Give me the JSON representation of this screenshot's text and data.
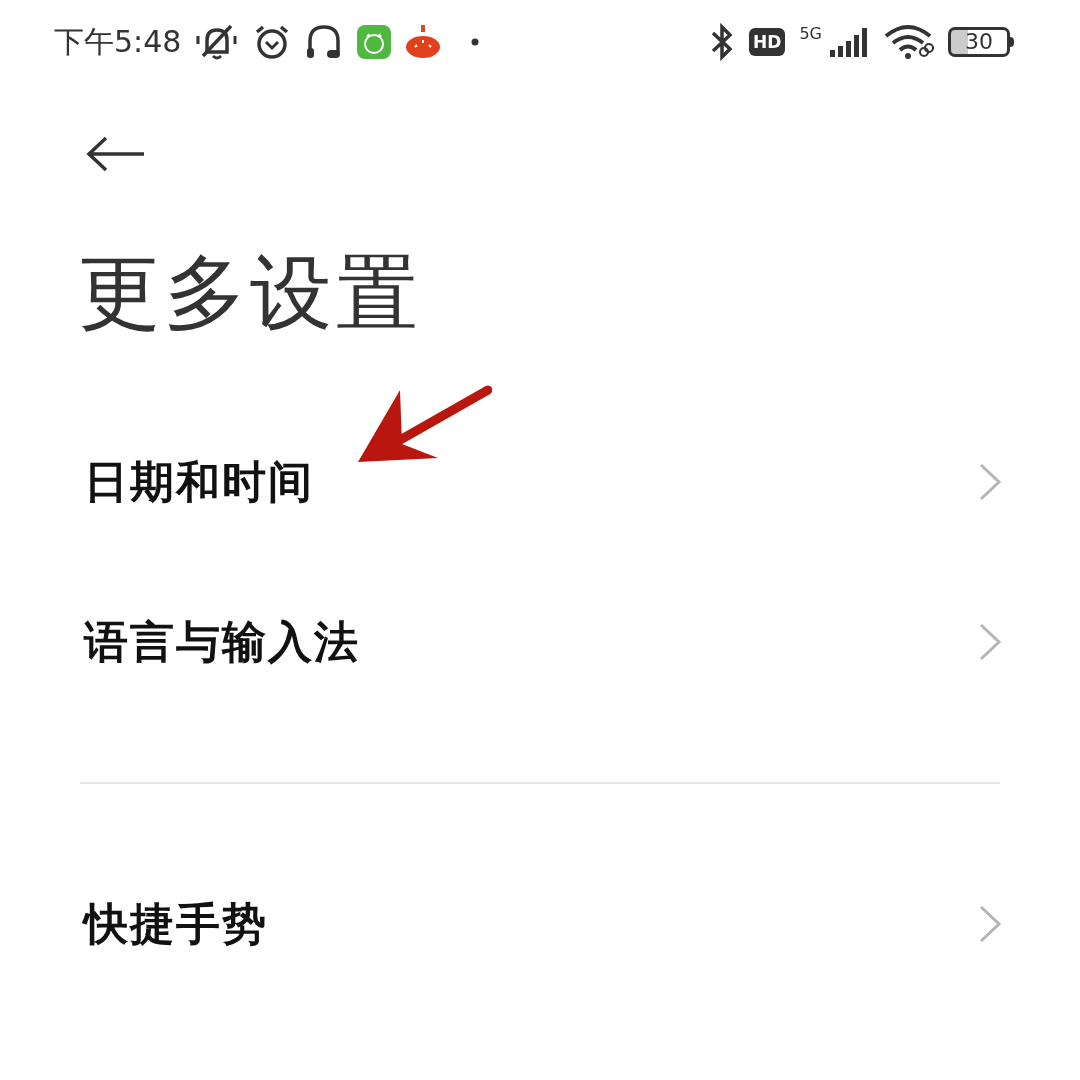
{
  "status_bar": {
    "time": "下午5:48",
    "network": "5G",
    "hd": "HD",
    "battery": "30"
  },
  "title": "更多设置",
  "annotation": {
    "kind": "arrow"
  },
  "groups": [
    {
      "items": [
        {
          "label": "日期和时间"
        },
        {
          "label": "语言与输入法"
        }
      ]
    },
    {
      "items": [
        {
          "label": "快捷手势"
        }
      ]
    }
  ]
}
